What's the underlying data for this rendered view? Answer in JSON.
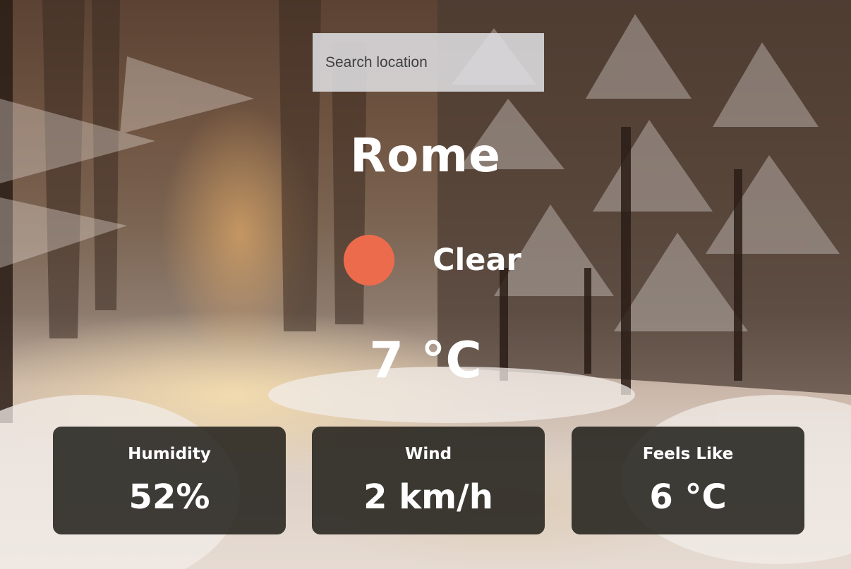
{
  "search": {
    "placeholder": "Search location",
    "value": ""
  },
  "location": {
    "city": "Rome"
  },
  "weather": {
    "condition": "Clear",
    "condition_icon": "sun-dot-icon",
    "condition_color": "#ec6b4d",
    "temperature": "7 °C"
  },
  "stats": [
    {
      "label": "Humidity",
      "value": "52%"
    },
    {
      "label": "Wind",
      "value": "2 km/h"
    },
    {
      "label": "Feels Like",
      "value": "6 °C"
    }
  ],
  "background": {
    "scene": "snowy forest road at sunset"
  }
}
